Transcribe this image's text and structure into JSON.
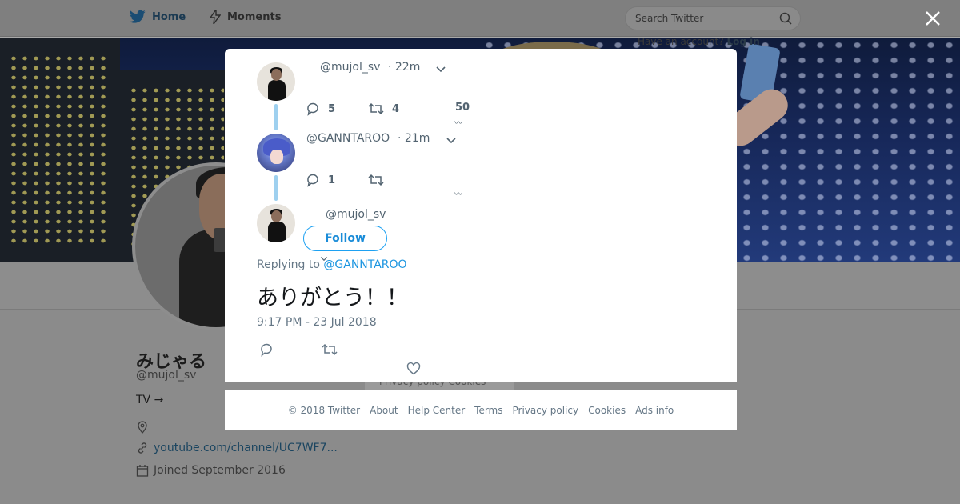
{
  "topbar": {
    "home_label": "Home",
    "moments_label": "Moments",
    "search_placeholder": "Search Twitter",
    "have_account_text": "Have an account?",
    "login_label": "Log in"
  },
  "profile": {
    "name": "みじゃる",
    "handle": "@mujol_sv",
    "bio": "TV →",
    "url": "youtube.com/channel/UC7WF7...",
    "joined": "Joined September 2016",
    "bg_footer_text": "Privacy policy   Cookies"
  },
  "thread": {
    "tweets": [
      {
        "handle": "@mujol_sv",
        "time": "· 22m",
        "replies": "5",
        "retweets": "4",
        "likes": "50"
      },
      {
        "handle": "@GANNTAROO",
        "time": "· 21m",
        "replies": "1",
        "retweets": "",
        "likes": ""
      }
    ],
    "main": {
      "handle": "@mujol_sv",
      "follow_label": "Follow",
      "replying_prefix": "Replying to",
      "replying_mention": "@GANNTAROO",
      "text": "ありがとう！！",
      "timestamp": "9:17 PM - 23 Jul 2018"
    }
  },
  "footer": {
    "copyright": "© 2018 Twitter",
    "about": "About",
    "help": "Help Center",
    "terms": "Terms",
    "privacy": "Privacy policy",
    "cookies": "Cookies",
    "ads": "Ads info"
  },
  "colors": {
    "accent": "#1da1f2",
    "thread_line": "#9ed0ef",
    "overlay": "#7f7f7f"
  }
}
